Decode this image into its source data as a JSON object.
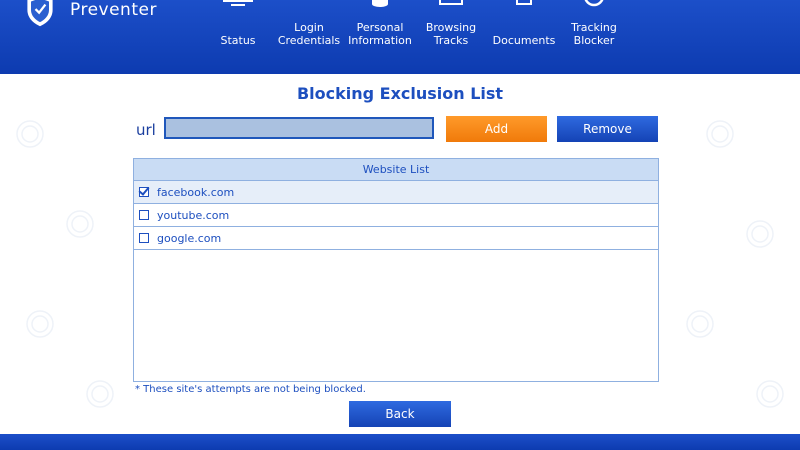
{
  "app": {
    "name": "Preventer"
  },
  "nav": {
    "items": [
      {
        "label": "Status",
        "icon": "monitor-icon"
      },
      {
        "label": "Login\nCredentials",
        "icon": "key-icon"
      },
      {
        "label": "Personal\nInformation",
        "icon": "database-icon"
      },
      {
        "label": "Browsing\nTracks",
        "icon": "browser-window-icon"
      },
      {
        "label": "Documents",
        "icon": "document-icon"
      },
      {
        "label": "Tracking\nBlocker",
        "icon": "target-icon"
      }
    ]
  },
  "page": {
    "title": "Blocking Exclusion List",
    "url_label": "url",
    "url_value": "",
    "add_label": "Add",
    "remove_label": "Remove",
    "list_header": "Website List",
    "sites": [
      {
        "name": "facebook.com",
        "checked": true
      },
      {
        "name": "youtube.com",
        "checked": false
      },
      {
        "name": "google.com",
        "checked": false
      }
    ],
    "note": "* These site's attempts are not being blocked.",
    "back_label": "Back"
  },
  "colors": {
    "header_blue": "#0d3bb0",
    "accent_blue": "#1d4fbf",
    "add_orange": "#f07a0a",
    "input_fill": "#aac1e0"
  }
}
